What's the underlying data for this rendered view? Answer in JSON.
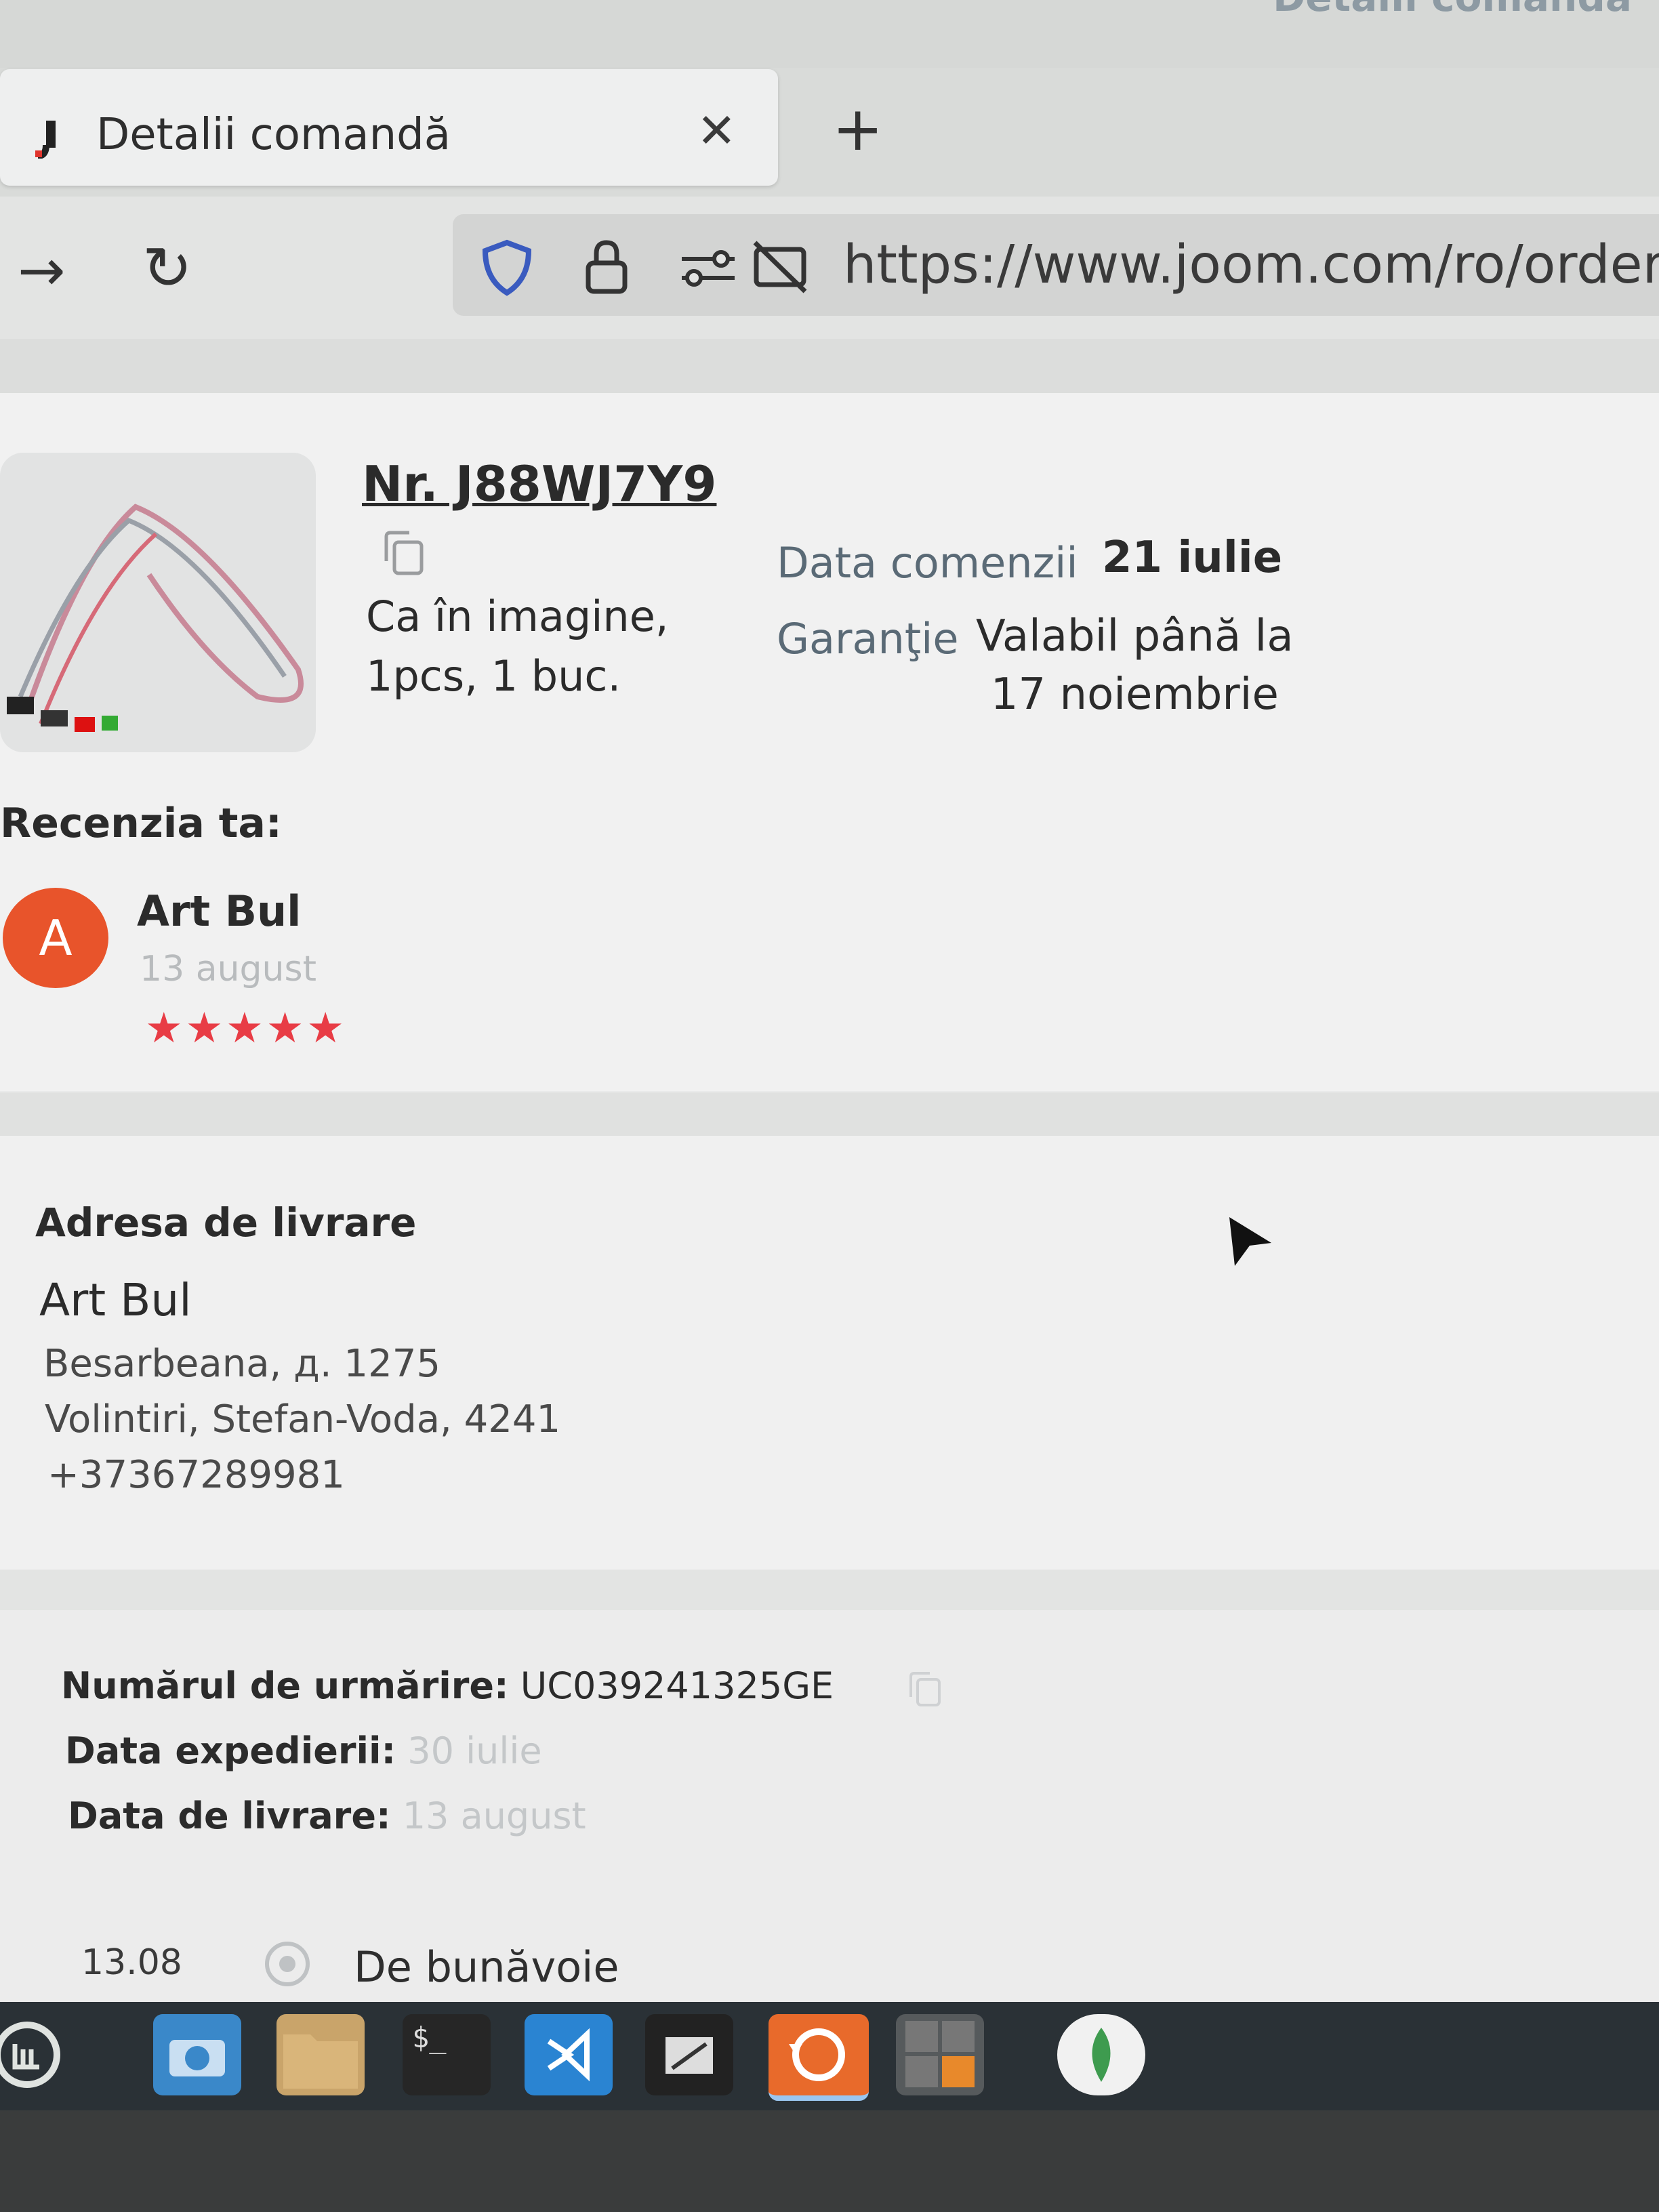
{
  "browser": {
    "top_ghost_text": "Detalii comandă",
    "tab": {
      "title": "Detalii comandă",
      "close": "✕",
      "new_tab": "+"
    },
    "nav": {
      "forward": "→",
      "reload": "↻"
    },
    "url": "https://www.joom.com/ro/orders/o"
  },
  "order": {
    "number": "Nr. J88WJ7Y9",
    "variant_line1": "Ca în imagine,",
    "variant_line2": "1pcs, 1 buc.",
    "date_label": "Data comenzii",
    "date_value": "21 iulie",
    "warranty_label": "Garanţie",
    "warranty_line1": "Valabil până la",
    "warranty_line2": "17 noiembrie"
  },
  "review": {
    "title": "Recenzia ta:",
    "avatar_letter": "A",
    "author": "Art Bul",
    "date": "13 august",
    "stars": "★★★★★",
    "rating": 5,
    "star_color": "#e83c45"
  },
  "address": {
    "title": "Adresa de livrare",
    "name": "Art Bul",
    "line1": "Besarbeana, д. 1275",
    "line2": "Volintiri, Stefan-Voda, 4241",
    "phone": "+37367289981"
  },
  "tracking": {
    "number_label": "Numărul de urmărire:",
    "number_value": "UC039241325GE",
    "shipped_label": "Data expedierii:",
    "shipped_value": "30 iulie",
    "delivered_label": "Data de livrare:",
    "delivered_value": "13 august"
  },
  "history": {
    "date": "13.08",
    "text": "De bunăvoie"
  },
  "taskbar": {
    "terminal_prompt": "$_",
    "apps": [
      "mint-menu-icon",
      "camera-icon",
      "folder-icon",
      "terminal-icon",
      "vscode-icon",
      "text-editor-icon",
      "sync-icon",
      "calculator-icon",
      "mongodb-icon"
    ]
  },
  "colors": {
    "avatar": "#e8542b",
    "accent_red": "#e83c45"
  }
}
